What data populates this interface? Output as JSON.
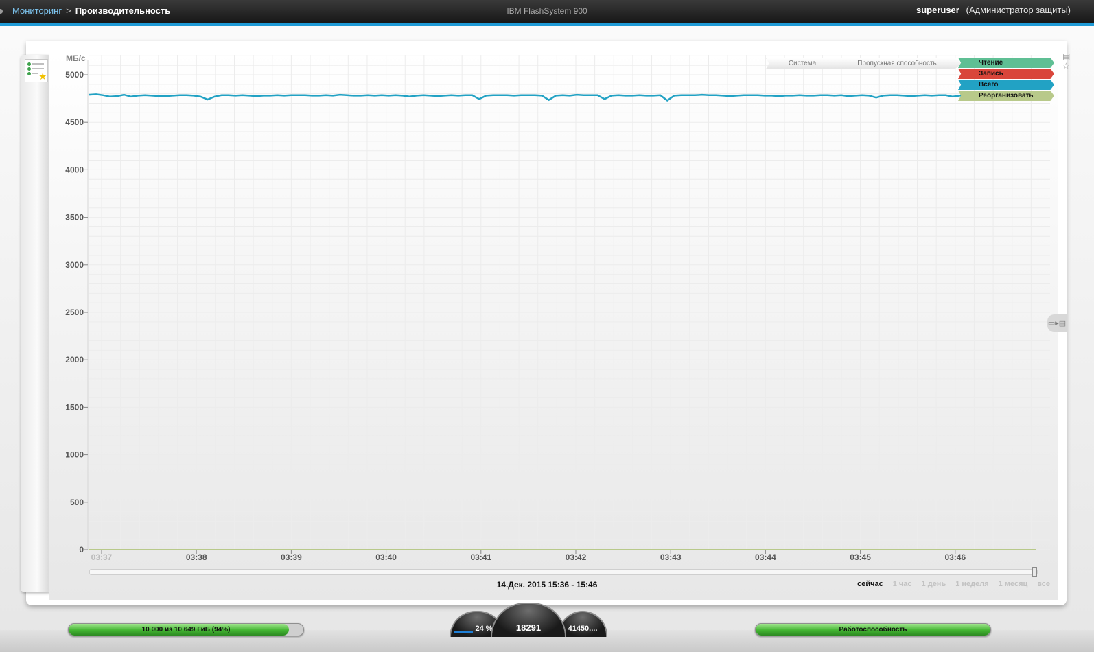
{
  "header": {
    "breadcrumb_parent": "Мониторинг",
    "breadcrumb_separator": ">",
    "breadcrumb_current": "Производительность",
    "app_title": "IBM FlashSystem 900",
    "user_name": "superuser",
    "user_role": "(Администратор защиты)"
  },
  "legend": {
    "crumbs": [
      "Система",
      "Пропускная способность"
    ],
    "series": [
      {
        "label": "Чтение",
        "color": "#5fbf94"
      },
      {
        "label": "Запись",
        "color": "#d9453a"
      },
      {
        "label": "Всего",
        "color": "#22a2c4"
      },
      {
        "label": "Реорганизовать",
        "color": "#b8c98a"
      }
    ]
  },
  "chart_data": {
    "type": "line",
    "ylabel": "МБ/с",
    "ylim": [
      0,
      5000
    ],
    "yticks": [
      0,
      500,
      1000,
      1500,
      2000,
      2500,
      3000,
      3500,
      4000,
      4500,
      5000
    ],
    "xticks": [
      "03:37",
      "03:38",
      "03:39",
      "03:40",
      "03:41",
      "03:42",
      "03:43",
      "03:44",
      "03:45",
      "03:46"
    ],
    "grid": true,
    "series": [
      {
        "name": "Всего",
        "color": "#22a2c4",
        "values": [
          4790,
          4795,
          4785,
          4770,
          4775,
          4790,
          4770,
          4780,
          4785,
          4780,
          4775,
          4775,
          4780,
          4785,
          4785,
          4780,
          4770,
          4740,
          4770,
          4785,
          4785,
          4780,
          4785,
          4780,
          4775,
          4780,
          4780,
          4785,
          4780,
          4785,
          4785,
          4785,
          4780,
          4780,
          4785,
          4780,
          4790,
          4785,
          4780,
          4780,
          4785,
          4780,
          4785,
          4780,
          4785,
          4780,
          4770,
          4780,
          4785,
          4780,
          4775,
          4780,
          4785,
          4780,
          4785,
          4785,
          4745,
          4780,
          4785,
          4785,
          4785,
          4780,
          4785,
          4785,
          4785,
          4780,
          4735,
          4780,
          4785,
          4780,
          4790,
          4785,
          4785,
          4785,
          4745,
          4780,
          4785,
          4780,
          4780,
          4785,
          4780,
          4780,
          4785,
          4730,
          4780,
          4785,
          4785,
          4785,
          4790,
          4785,
          4785,
          4780,
          4775,
          4780,
          4785,
          4785,
          4785,
          4780,
          4780,
          4775,
          4780,
          4780,
          4785,
          4780,
          4780,
          4785,
          4785,
          4780,
          4785,
          4775,
          4780,
          4785,
          4780,
          4760,
          4780,
          4785,
          4785,
          4780,
          4775,
          4780,
          4785,
          4780,
          4785,
          4785,
          4770,
          4780,
          4785,
          4780,
          4785,
          4785,
          4780,
          4775,
          4780,
          4780,
          4785,
          4785,
          4780
        ]
      },
      {
        "name": "Реорганизовать",
        "color": "#b8c98a",
        "values": [
          0,
          0,
          0,
          0,
          0,
          0,
          0,
          0,
          0,
          0,
          0
        ]
      }
    ]
  },
  "time_range": "14.Дек. 2015 15:36 - 15:46",
  "periods": [
    {
      "label": "сейчас",
      "active": true
    },
    {
      "label": "1 час",
      "active": false
    },
    {
      "label": "1 день",
      "active": false
    },
    {
      "label": "1 неделя",
      "active": false
    },
    {
      "label": "1 месяц",
      "active": false
    },
    {
      "label": "все",
      "active": false
    }
  ],
  "status": {
    "capacity_text": "10 000 из 10 649 ГиБ (94%)",
    "capacity_fraction": 0.94,
    "health_text": "Работоспособность",
    "health_fraction": 1.0,
    "gauge_left": "24 %",
    "gauge_center": "18291",
    "gauge_right": "41450...."
  },
  "icons": {
    "favorites": "favorites-list-icon",
    "save": "save-icon",
    "star": "star-icon",
    "split": "split-view-icon"
  }
}
